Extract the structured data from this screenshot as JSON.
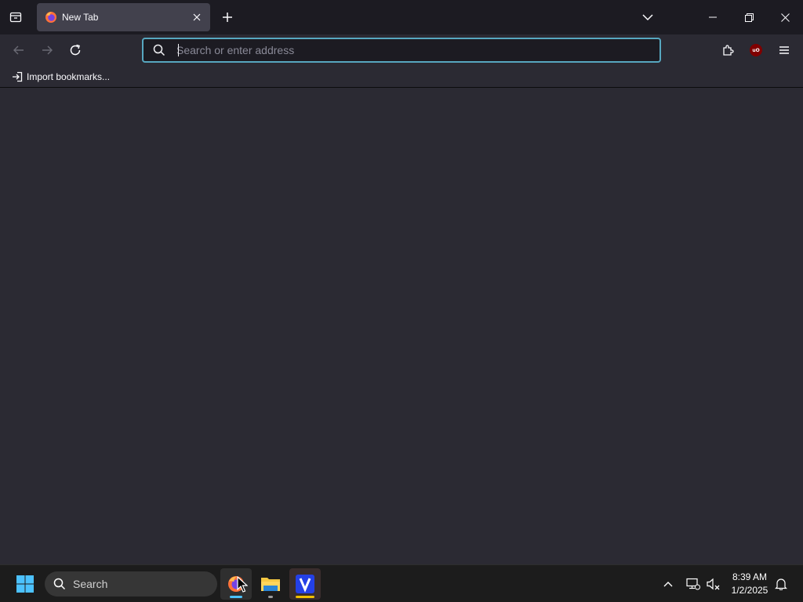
{
  "browser": {
    "tab": {
      "title": "New Tab"
    },
    "urlbar": {
      "placeholder": "Search or enter address",
      "value": ""
    },
    "bookmarks": {
      "import_label": "Import bookmarks..."
    },
    "extensions": {
      "ublock_badge": "uO"
    }
  },
  "taskbar": {
    "search_label": "Search",
    "clock": {
      "time": "8:39 AM",
      "date": "1/2/2025"
    },
    "apps": [
      {
        "name": "Firefox",
        "icon": "firefox-icon",
        "indicator_color": "#4cc2ff"
      },
      {
        "name": "File Explorer",
        "icon": "folder-icon",
        "indicator_color": "#9a9a9a"
      },
      {
        "name": "V app",
        "icon": "v-app-icon",
        "indicator_color": "#f0c000"
      }
    ]
  },
  "colors": {
    "tabstrip_bg": "#1c1b22",
    "toolbar_bg": "#2b2a33",
    "active_tab_bg": "#42414d",
    "urlbar_focus": "#00ddff",
    "taskbar_bg": "#1c1c1c",
    "windows_accent": "#4cc2ff"
  }
}
